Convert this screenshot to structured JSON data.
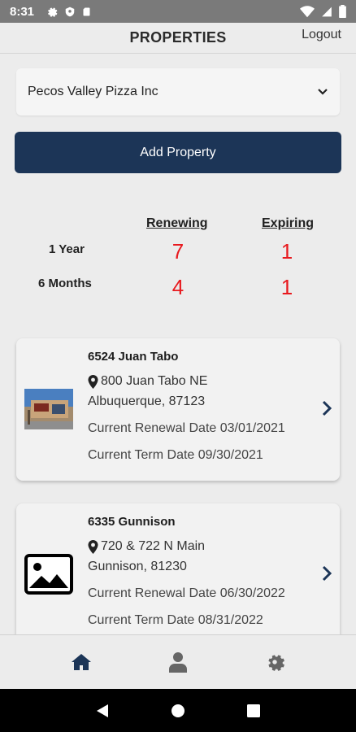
{
  "status_bar": {
    "time": "8:31",
    "left_icons": [
      "gear-icon",
      "shield-icon",
      "sd-card-icon"
    ],
    "right_icons": [
      "wifi-icon",
      "signal-icon",
      "battery-icon"
    ]
  },
  "header": {
    "title": "PROPERTIES",
    "logout_label": "Logout"
  },
  "company_select": {
    "selected": "Pecos Valley Pizza Inc"
  },
  "add_property_label": "Add Property",
  "stats": {
    "headers": {
      "renewing": "Renewing",
      "expiring": "Expiring"
    },
    "rows": [
      {
        "label": "1 Year",
        "renewing": "7",
        "expiring": "1"
      },
      {
        "label": "6 Months",
        "renewing": "4",
        "expiring": "1"
      }
    ],
    "accent_color": "#e8191e"
  },
  "properties": [
    {
      "name": "6524 Juan Tabo",
      "address_line1": "800 Juan Tabo NE",
      "address_line2": "Albuquerque,  87123",
      "renewal": "Current Renewal Date 03/01/2021",
      "term": "Current Term Date 09/30/2021",
      "thumbnail": "storefront-photo"
    },
    {
      "name": "6335 Gunnison",
      "address_line1": "720 & 722 N Main",
      "address_line2": "Gunnison,  81230",
      "renewal": "Current Renewal Date 06/30/2022",
      "term": "Current Term Date 08/31/2022",
      "thumbnail": "image-placeholder-icon"
    }
  ],
  "bottom_nav": [
    "home-icon",
    "user-icon",
    "settings-icon"
  ],
  "colors": {
    "primary": "#1c3557",
    "nav_active": "#1c3557",
    "nav_inactive": "#666666"
  }
}
